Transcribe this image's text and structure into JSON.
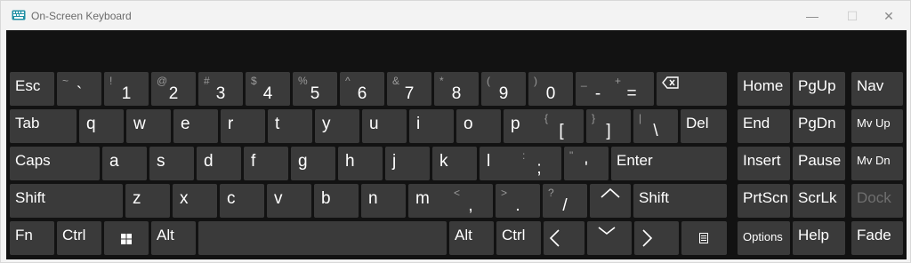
{
  "window": {
    "title": "On-Screen Keyboard",
    "controls": {
      "minimize": "—",
      "maximize": "☐",
      "close": "✕"
    }
  },
  "keys": {
    "esc": "Esc",
    "tilde": {
      "main": "`",
      "secondary": "~"
    },
    "1": {
      "main": "1",
      "secondary": "!"
    },
    "2": {
      "main": "2",
      "secondary": "@"
    },
    "3": {
      "main": "3",
      "secondary": "#"
    },
    "4": {
      "main": "4",
      "secondary": "$"
    },
    "5": {
      "main": "5",
      "secondary": "%"
    },
    "6": {
      "main": "6",
      "secondary": "^"
    },
    "7": {
      "main": "7",
      "secondary": "&"
    },
    "8": {
      "main": "8",
      "secondary": "*"
    },
    "9": {
      "main": "9",
      "secondary": "("
    },
    "0": {
      "main": "0",
      "secondary": ")"
    },
    "minus": {
      "main": "-",
      "secondary": "_"
    },
    "equals": {
      "main": "=",
      "secondary": "+"
    },
    "backspace": "backspace-icon",
    "home": "Home",
    "pgup": "PgUp",
    "nav": "Nav",
    "tab": "Tab",
    "q": "q",
    "w": "w",
    "e": "e",
    "r": "r",
    "t": "t",
    "y": "y",
    "u": "u",
    "i": "i",
    "o": "o",
    "p": "p",
    "lbracket": {
      "main": "[",
      "secondary": "{"
    },
    "rbracket": {
      "main": "]",
      "secondary": "}"
    },
    "backslash": {
      "main": "\\",
      "secondary": "|"
    },
    "del": "Del",
    "end": "End",
    "pgdn": "PgDn",
    "mvup": "Mv Up",
    "caps": "Caps",
    "a": "a",
    "s": "s",
    "d": "d",
    "f": "f",
    "g": "g",
    "h": "h",
    "j": "j",
    "k": "k",
    "l": "l",
    "semicolon": {
      "main": ";",
      "secondary": ":"
    },
    "quote": {
      "main": "'",
      "secondary": "\""
    },
    "enter": "Enter",
    "insert": "Insert",
    "pause": "Pause",
    "mvdn": "Mv Dn",
    "shift_left": "Shift",
    "z": "z",
    "x": "x",
    "c": "c",
    "v": "v",
    "b": "b",
    "n": "n",
    "m": "m",
    "comma": {
      "main": ",",
      "secondary": "<"
    },
    "period": {
      "main": ".",
      "secondary": ">"
    },
    "slash": {
      "main": "/",
      "secondary": "?"
    },
    "up": "chevron-up-icon",
    "shift_right": "Shift",
    "prtscn": "PrtScn",
    "scrlk": "ScrLk",
    "dock": "Dock",
    "fn": "Fn",
    "ctrl_left": "Ctrl",
    "win": "windows-icon",
    "alt_left": "Alt",
    "alt_right": "Alt",
    "ctrl_right": "Ctrl",
    "left": "chevron-left-icon",
    "down": "chevron-down-icon",
    "right": "chevron-right-icon",
    "menu": "menu-icon",
    "options": "Options",
    "help": "Help",
    "fade": "Fade"
  },
  "colors": {
    "key": "#3a3a3a",
    "background": "#121212",
    "disabled_text": "#6f6f6f"
  }
}
